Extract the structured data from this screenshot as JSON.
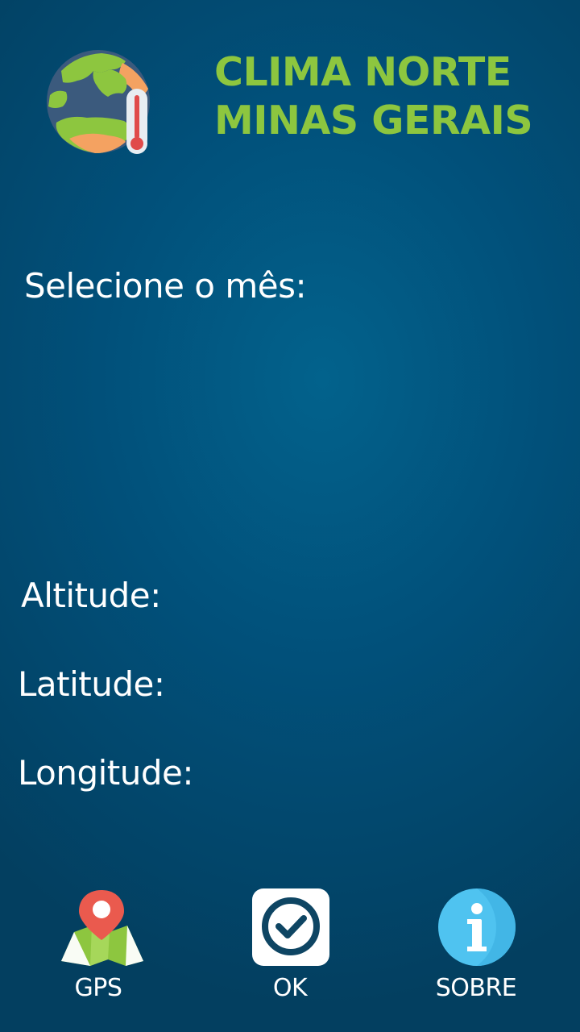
{
  "header": {
    "title_line1": "CLIMA NORTE",
    "title_line2": "MINAS GERAIS",
    "logo_icon": "earth-thermometer-icon"
  },
  "form": {
    "month_label": "Selecione o mês:",
    "altitude_label": "Altitude:",
    "latitude_label": "Latitude:",
    "longitude_label": "Longitude:"
  },
  "bottom_bar": {
    "gps": {
      "label": "GPS",
      "icon": "map-pin-icon"
    },
    "ok": {
      "label": "OK",
      "icon": "checkmark-icon"
    },
    "sobre": {
      "label": "SOBRE",
      "icon": "info-icon"
    }
  },
  "colors": {
    "title": "#8dc63f",
    "background_center": "#02628c",
    "background_edge": "#033f60",
    "text": "#ffffff"
  }
}
